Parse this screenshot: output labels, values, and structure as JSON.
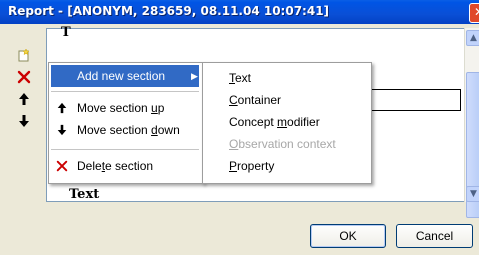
{
  "window": {
    "title": "Report - [ANONYM, 283659, 08.11.04 10:07:41]",
    "close_glyph": "✕"
  },
  "editor": {
    "visible_text_bottom": "Text",
    "visible_text_top_partial": "T"
  },
  "toolbar": {
    "icons": [
      "new-section-icon",
      "delete-icon",
      "arrow-up-icon",
      "arrow-down-icon"
    ]
  },
  "context_menu": {
    "items": [
      {
        "label_pre": "Add new section",
        "label_u": "",
        "label_post": "",
        "has_submenu": true,
        "icon": ""
      },
      {
        "label_pre": "Move section ",
        "label_u": "u",
        "label_post": "p",
        "icon": "arrow-up-icon"
      },
      {
        "label_pre": "Move section ",
        "label_u": "d",
        "label_post": "own",
        "icon": "arrow-down-icon"
      },
      {
        "label_pre": "Dele",
        "label_u": "t",
        "label_post": "e section",
        "icon": "delete-icon"
      }
    ]
  },
  "submenu": {
    "items": [
      {
        "label_u": "T",
        "label_post": "ext",
        "disabled": false
      },
      {
        "label_u": "C",
        "label_post": "ontainer",
        "disabled": false
      },
      {
        "label_u": "",
        "label_pre": "Concept ",
        "label_u2": "m",
        "label_post": "odifier",
        "disabled": false
      },
      {
        "label_u": "O",
        "label_post": "bservation context",
        "disabled": true
      },
      {
        "label_u": "P",
        "label_post": "roperty",
        "disabled": false
      }
    ]
  },
  "buttons": {
    "ok_label": "OK",
    "cancel_label": "Cancel"
  },
  "colors": {
    "title_bar": "#0054e3",
    "menu_highlight": "#316ac5",
    "delete_red": "#cc0000"
  }
}
